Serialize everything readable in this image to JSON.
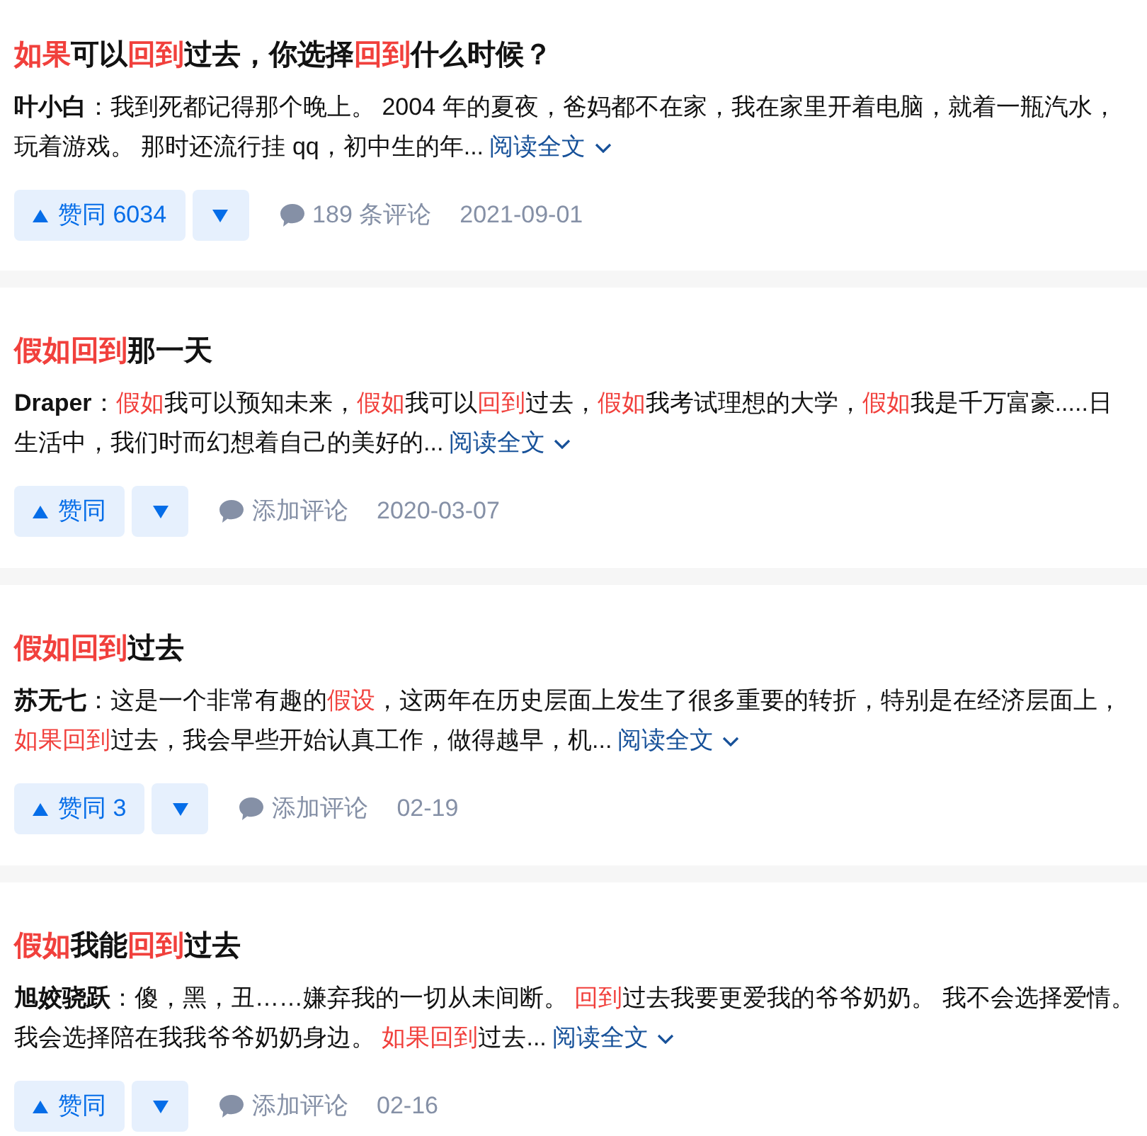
{
  "results": [
    {
      "title": [
        {
          "text": "如果",
          "highlight": true
        },
        {
          "text": "可以",
          "highlight": false
        },
        {
          "text": "回到",
          "highlight": true
        },
        {
          "text": "过去，你选择",
          "highlight": false
        },
        {
          "text": "回到",
          "highlight": true
        },
        {
          "text": "什么时候？",
          "highlight": false
        }
      ],
      "author": "叶小白",
      "excerpt_lines": [
        [
          {
            "text": "：我到死都记得那个晚上。 2004 年的夏夜，爸妈都不在家，我在家里开着电脑，就着一瓶汽水，",
            "highlight": false
          }
        ],
        [
          {
            "text": "玩着游戏。 那时还流行挂 qq，初中生的年...",
            "highlight": false
          }
        ]
      ],
      "read_more": "阅读全文",
      "upvote": "赞同 6034",
      "comment": "189 条评论",
      "date": "2021-09-01"
    },
    {
      "title": [
        {
          "text": "假如回到",
          "highlight": true
        },
        {
          "text": "那一天",
          "highlight": false
        }
      ],
      "author": "Draper",
      "excerpt_lines": [
        [
          {
            "text": "：",
            "highlight": false
          },
          {
            "text": "假如",
            "highlight": true
          },
          {
            "text": "我可以预知未来，",
            "highlight": false
          },
          {
            "text": "假如",
            "highlight": true
          },
          {
            "text": "我可以",
            "highlight": false
          },
          {
            "text": "回到",
            "highlight": true
          },
          {
            "text": "过去，",
            "highlight": false
          },
          {
            "text": "假如",
            "highlight": true
          },
          {
            "text": "我考试理想的大学，",
            "highlight": false
          },
          {
            "text": "假如",
            "highlight": true
          },
          {
            "text": "我是千万富豪.....日",
            "highlight": false
          }
        ],
        [
          {
            "text": "生活中，我们时而幻想着自己的美好的...",
            "highlight": false
          }
        ]
      ],
      "read_more": "阅读全文",
      "upvote": "赞同",
      "comment": "添加评论",
      "date": "2020-03-07"
    },
    {
      "title": [
        {
          "text": "假如回到",
          "highlight": true
        },
        {
          "text": "过去",
          "highlight": false
        }
      ],
      "author": "苏无七",
      "excerpt_lines": [
        [
          {
            "text": "：这是一个非常有趣的",
            "highlight": false
          },
          {
            "text": "假设",
            "highlight": true
          },
          {
            "text": "，这两年在历史层面上发生了很多重要的转折，特别是在经济层面上，",
            "highlight": false
          }
        ],
        [
          {
            "text": "如果回到",
            "highlight": true
          },
          {
            "text": "过去，我会早些开始认真工作，做得越早，机...",
            "highlight": false
          }
        ]
      ],
      "read_more": "阅读全文",
      "upvote": "赞同 3",
      "comment": "添加评论",
      "date": "02-19"
    },
    {
      "title": [
        {
          "text": "假如",
          "highlight": true
        },
        {
          "text": "我能",
          "highlight": false
        },
        {
          "text": "回到",
          "highlight": true
        },
        {
          "text": "过去",
          "highlight": false
        }
      ],
      "author": "旭姣骁跃",
      "excerpt_lines": [
        [
          {
            "text": "：傻，黑，丑……嫌弃我的一切从未间断。 ",
            "highlight": false
          },
          {
            "text": "回到",
            "highlight": true
          },
          {
            "text": "过去我要更爱我的爷爷奶奶。 我不会选择爱情。",
            "highlight": false
          }
        ],
        [
          {
            "text": "我会选择陪在我我爷爷奶奶身边。 ",
            "highlight": false
          },
          {
            "text": "如果回到",
            "highlight": true
          },
          {
            "text": "过去...",
            "highlight": false
          }
        ]
      ],
      "read_more": "阅读全文",
      "upvote": "赞同",
      "comment": "添加评论",
      "date": "02-16"
    }
  ]
}
